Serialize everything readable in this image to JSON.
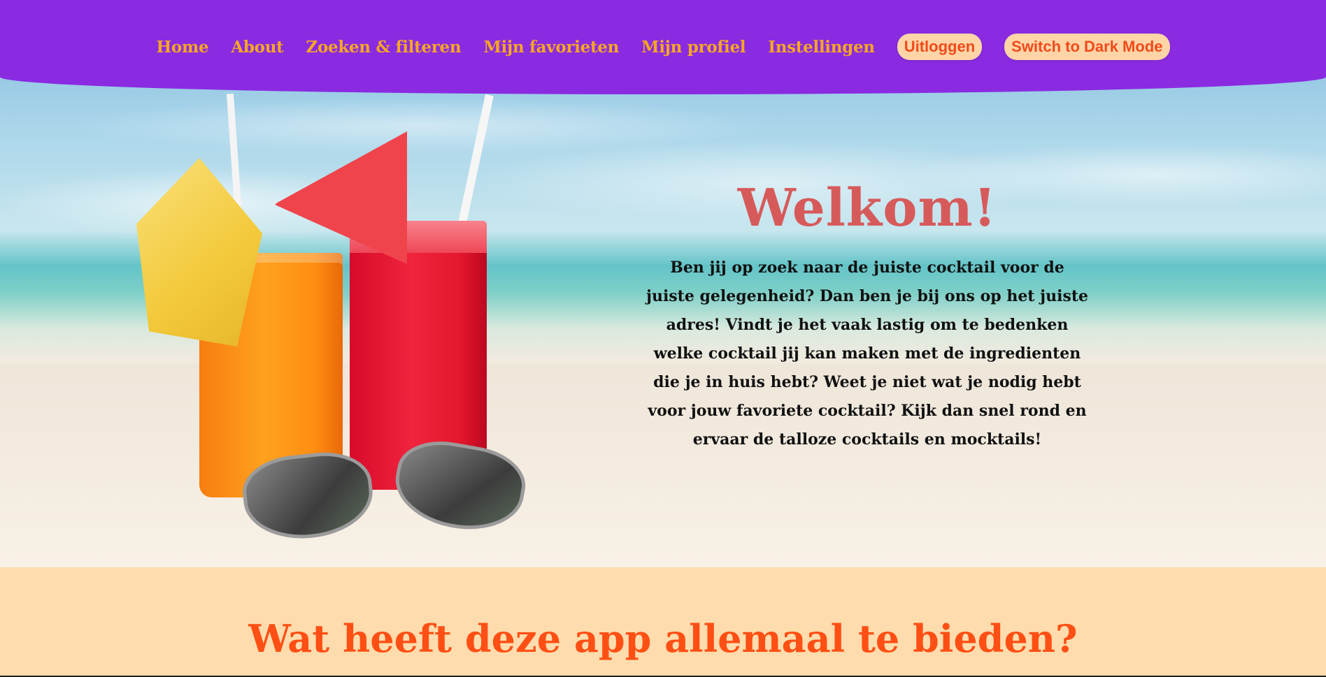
{
  "nav": {
    "links": [
      "Home",
      "About",
      "Zoeken & filteren",
      "Mijn favorieten",
      "Mijn profiel",
      "Instellingen"
    ],
    "logout_label": "Uitloggen",
    "dark_mode_label": "Switch to Dark Mode"
  },
  "hero": {
    "title": "Welkom!",
    "text": "Ben jij op zoek naar de juiste cocktail voor de juiste gelegenheid? Dan ben je bij ons op het juiste adres! Vindt je het vaak lastig om te bedenken welke cocktail jij kan maken met de ingredienten die je in huis hebt? Weet je niet wat je nodig hebt voor jouw favoriete cocktail? Kijk dan snel rond en ervaar de talloze cocktails en mocktails!"
  },
  "section": {
    "heading": "Wat heeft deze app allemaal te bieden?"
  },
  "colors": {
    "header_bg": "#8a2be2",
    "nav_text": "#f6a623",
    "pill_bg": "#ffd5a8",
    "pill_text": "#f24a1a",
    "welcome_title": "#d75a5a",
    "section_bg": "#ffdcad",
    "section_heading": "#ff4f14"
  }
}
